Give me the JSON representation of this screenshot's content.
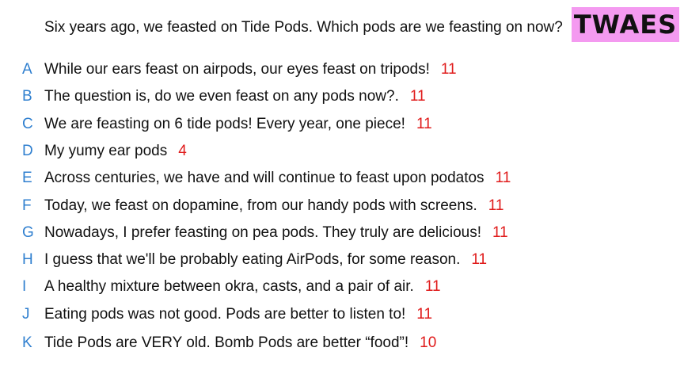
{
  "question": "Six years ago, we feasted on Tide Pods. Which pods are we feasting on now?",
  "badge": {
    "label": "TWAES",
    "color": "#f49af0"
  },
  "colors": {
    "letter": "#2f7fcf",
    "score": "#e01b1b",
    "text": "#111111"
  },
  "answers": [
    {
      "letter": "A",
      "text": "While our ears feast on airpods, our eyes feast on tripods!",
      "score": "11"
    },
    {
      "letter": "B",
      "text": "The question is, do we even feast on any pods now?.",
      "score": "11"
    },
    {
      "letter": "C",
      "text": "We are feasting on 6 tide pods! Every year, one piece!",
      "score": "11"
    },
    {
      "letter": "D",
      "text": "My yumy ear pods",
      "score": "4"
    },
    {
      "letter": "E",
      "text": "Across centuries, we have and will continue to feast upon podatos",
      "score": "11"
    },
    {
      "letter": "F",
      "text": "Today, we feast on dopamine, from our handy pods with screens.",
      "score": "11"
    },
    {
      "letter": "G",
      "text": "Nowadays, I prefer feasting on pea pods. They truly are delicious!",
      "score": "11"
    },
    {
      "letter": "H",
      "text": "I guess that we'll be probably eating AirPods, for some reason.",
      "score": "11"
    },
    {
      "letter": "I",
      "text": "A healthy mixture between okra, casts, and a pair of air.",
      "score": "11"
    },
    {
      "letter": "J",
      "text": "Eating pods was not good. Pods are better to listen to!",
      "score": "11"
    },
    {
      "letter": "K",
      "text": "Tide Pods are VERY old. Bomb Pods are better “food”!",
      "score": "10"
    }
  ]
}
